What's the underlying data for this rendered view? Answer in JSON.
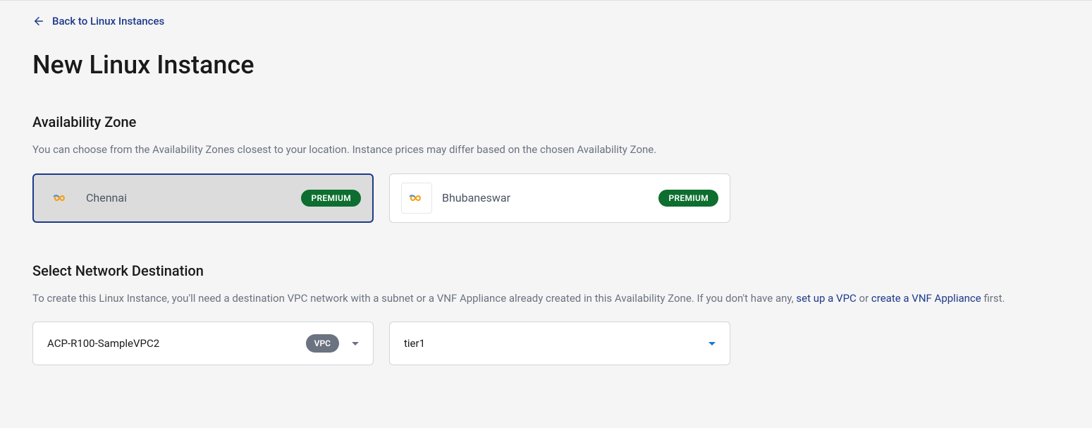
{
  "back_link": {
    "label": "Back to Linux Instances"
  },
  "page_title": "New Linux Instance",
  "availability_zone": {
    "title": "Availability Zone",
    "description": "You can choose from the Availability Zones closest to your location. Instance prices may differ based on the chosen Availability Zone.",
    "zones": [
      {
        "name": "Chennai",
        "badge": "PREMIUM",
        "selected": true
      },
      {
        "name": "Bhubaneswar",
        "badge": "PREMIUM",
        "selected": false
      }
    ]
  },
  "network_destination": {
    "title": "Select Network Destination",
    "desc_part1": "To create this Linux Instance, you'll need a destination VPC network with a subnet or a VNF Appliance already created in this Availability Zone. If you don't have any, ",
    "link1": "set up a VPC",
    "desc_mid": " or ",
    "link2": "create a VNF Appliance",
    "desc_end": " first.",
    "vpc_select": {
      "value": "ACP-R100-SampleVPC2",
      "pill": "VPC"
    },
    "tier_select": {
      "value": "tier1"
    }
  }
}
